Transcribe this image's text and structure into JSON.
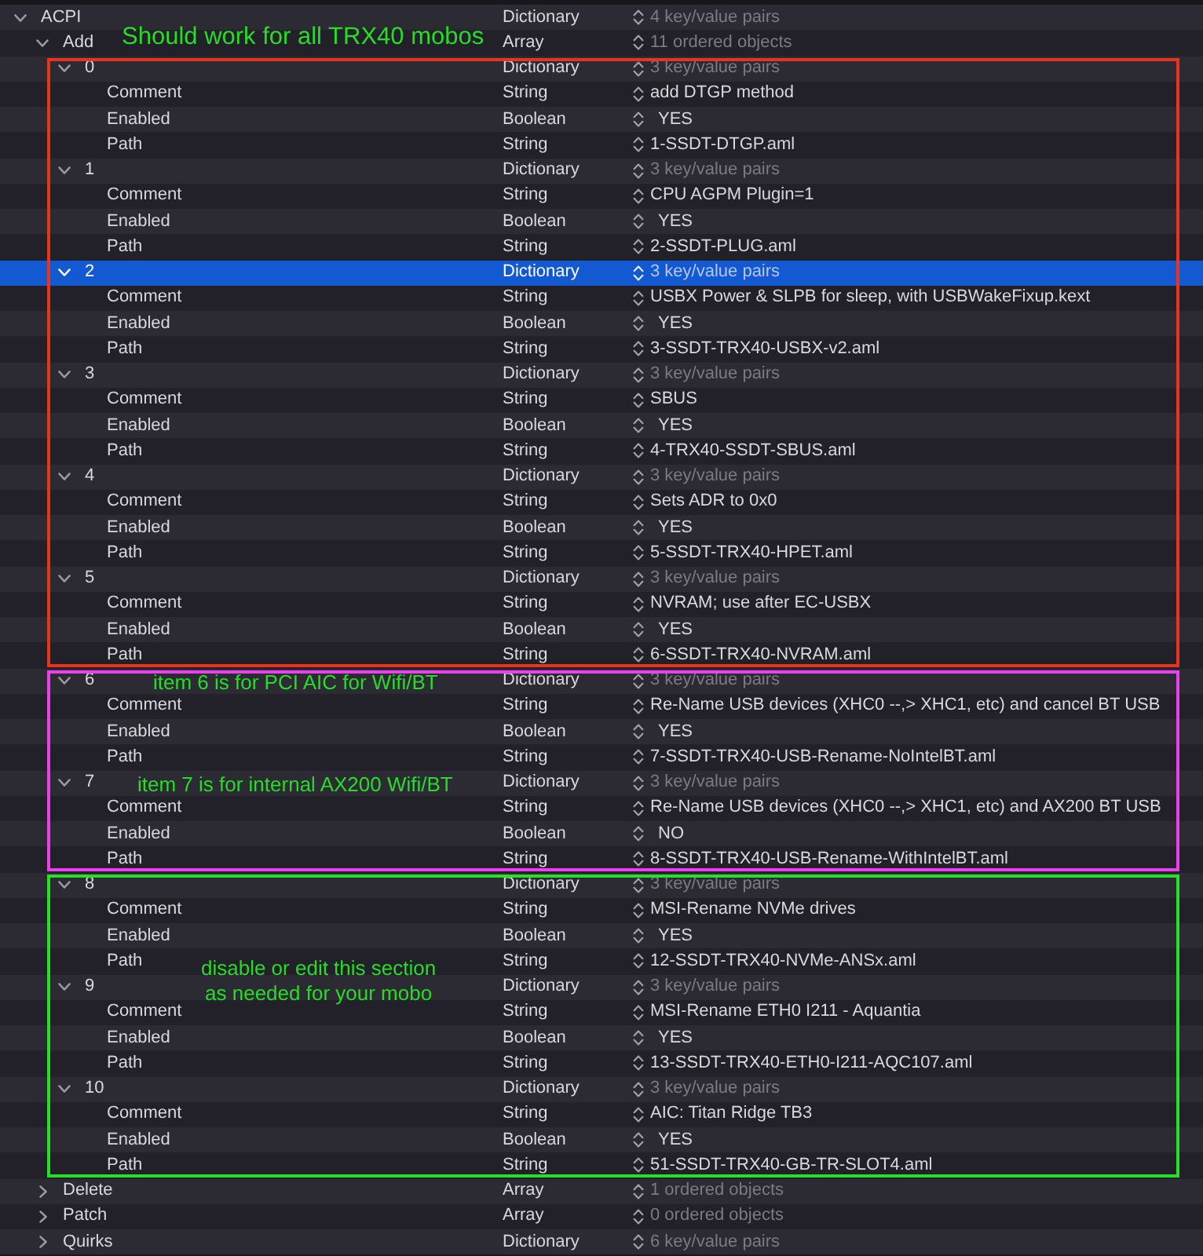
{
  "tree": [
    {
      "key": "ACPI",
      "type": "Dictionary",
      "value": "4 key/value pairs",
      "expanded": true,
      "selected": false,
      "children": [
        {
          "key": "Add",
          "type": "Array",
          "value": "11 ordered objects",
          "expanded": true,
          "selected": false,
          "sections": [
            {
              "color": "#e8341f",
              "note": {
                "kind": "above",
                "lines": [
                  "Should work for all TRX40 mobos"
                ]
              },
              "children": [
                {
                  "key": "0",
                  "type": "Dictionary",
                  "value": "3 key/value pairs",
                  "expanded": true,
                  "selected": false,
                  "children": [
                    {
                      "key": "Comment",
                      "type": "String",
                      "value": "add DTGP method",
                      "kind": "text",
                      "selected": false
                    },
                    {
                      "key": "Enabled",
                      "type": "Boolean",
                      "value": "YES",
                      "kind": "toggle",
                      "selected": false
                    },
                    {
                      "key": "Path",
                      "type": "String",
                      "value": "1-SSDT-DTGP.aml",
                      "kind": "text",
                      "selected": false
                    }
                  ]
                },
                {
                  "key": "1",
                  "type": "Dictionary",
                  "value": "3 key/value pairs",
                  "expanded": true,
                  "selected": false,
                  "children": [
                    {
                      "key": "Comment",
                      "type": "String",
                      "value": "CPU AGPM Plugin=1",
                      "kind": "text",
                      "selected": false
                    },
                    {
                      "key": "Enabled",
                      "type": "Boolean",
                      "value": "YES",
                      "kind": "toggle",
                      "selected": false
                    },
                    {
                      "key": "Path",
                      "type": "String",
                      "value": "2-SSDT-PLUG.aml",
                      "kind": "text",
                      "selected": false
                    }
                  ]
                },
                {
                  "key": "2",
                  "type": "Dictionary",
                  "value": "3 key/value pairs",
                  "expanded": true,
                  "selected": true,
                  "children": [
                    {
                      "key": "Comment",
                      "type": "String",
                      "value": "USBX Power & SLPB for sleep, with USBWakeFixup.kext",
                      "kind": "text",
                      "selected": false
                    },
                    {
                      "key": "Enabled",
                      "type": "Boolean",
                      "value": "YES",
                      "kind": "toggle",
                      "selected": false
                    },
                    {
                      "key": "Path",
                      "type": "String",
                      "value": "3-SSDT-TRX40-USBX-v2.aml",
                      "kind": "text",
                      "selected": false
                    }
                  ]
                },
                {
                  "key": "3",
                  "type": "Dictionary",
                  "value": "3 key/value pairs",
                  "expanded": true,
                  "selected": false,
                  "children": [
                    {
                      "key": "Comment",
                      "type": "String",
                      "value": "SBUS",
                      "kind": "text",
                      "selected": false
                    },
                    {
                      "key": "Enabled",
                      "type": "Boolean",
                      "value": "YES",
                      "kind": "toggle",
                      "selected": false
                    },
                    {
                      "key": "Path",
                      "type": "String",
                      "value": "4-TRX40-SSDT-SBUS.aml",
                      "kind": "text",
                      "selected": false
                    }
                  ]
                },
                {
                  "key": "4",
                  "type": "Dictionary",
                  "value": "3 key/value pairs",
                  "expanded": true,
                  "selected": false,
                  "children": [
                    {
                      "key": "Comment",
                      "type": "String",
                      "value": "Sets ADR to 0x0",
                      "kind": "text",
                      "selected": false
                    },
                    {
                      "key": "Enabled",
                      "type": "Boolean",
                      "value": "YES",
                      "kind": "toggle",
                      "selected": false
                    },
                    {
                      "key": "Path",
                      "type": "String",
                      "value": "5-SSDT-TRX40-HPET.aml",
                      "kind": "text",
                      "selected": false
                    }
                  ]
                },
                {
                  "key": "5",
                  "type": "Dictionary",
                  "value": "3 key/value pairs",
                  "expanded": true,
                  "selected": false,
                  "children": [
                    {
                      "key": "Comment",
                      "type": "String",
                      "value": "NVRAM; use after EC-USBX",
                      "kind": "text",
                      "selected": false
                    },
                    {
                      "key": "Enabled",
                      "type": "Boolean",
                      "value": "YES",
                      "kind": "toggle",
                      "selected": false
                    },
                    {
                      "key": "Path",
                      "type": "String",
                      "value": "6-SSDT-TRX40-NVRAM.aml",
                      "kind": "text",
                      "selected": false
                    }
                  ]
                }
              ]
            },
            {
              "color": "#ee3fee",
              "children": [
                {
                  "key": "6",
                  "type": "Dictionary",
                  "value": "3 key/value pairs",
                  "expanded": true,
                  "selected": false,
                  "note": {
                    "kind": "inline",
                    "lines": [
                      "item 6 is for PCI AIC for Wifi/BT"
                    ]
                  },
                  "children": [
                    {
                      "key": "Comment",
                      "type": "String",
                      "value": "Re-Name USB devices (XHC0 --,> XHC1, etc) and cancel BT USB",
                      "kind": "text",
                      "selected": false
                    },
                    {
                      "key": "Enabled",
                      "type": "Boolean",
                      "value": "YES",
                      "kind": "toggle",
                      "selected": false
                    },
                    {
                      "key": "Path",
                      "type": "String",
                      "value": "7-SSDT-TRX40-USB-Rename-NoIntelBT.aml",
                      "kind": "text",
                      "selected": false
                    }
                  ]
                },
                {
                  "key": "7",
                  "type": "Dictionary",
                  "value": "3 key/value pairs",
                  "expanded": true,
                  "selected": false,
                  "note": {
                    "kind": "inline",
                    "lines": [
                      "item 7 is for internal AX200 Wifi/BT"
                    ]
                  },
                  "children": [
                    {
                      "key": "Comment",
                      "type": "String",
                      "value": "Re-Name USB devices (XHC0 --,> XHC1, etc) and AX200 BT USB",
                      "kind": "text",
                      "selected": false
                    },
                    {
                      "key": "Enabled",
                      "type": "Boolean",
                      "value": "NO",
                      "kind": "toggle",
                      "selected": false
                    },
                    {
                      "key": "Path",
                      "type": "String",
                      "value": "8-SSDT-TRX40-USB-Rename-WithIntelBT.aml",
                      "kind": "text",
                      "selected": false
                    }
                  ]
                }
              ]
            },
            {
              "color": "#25e025",
              "note": {
                "kind": "after",
                "lines": [
                  "disable or edit this section",
                  "as needed for your mobo"
                ]
              },
              "children": [
                {
                  "key": "8",
                  "type": "Dictionary",
                  "value": "3 key/value pairs",
                  "expanded": true,
                  "selected": false,
                  "children": [
                    {
                      "key": "Comment",
                      "type": "String",
                      "value": "MSI-Rename NVMe drives",
                      "kind": "text",
                      "selected": false
                    },
                    {
                      "key": "Enabled",
                      "type": "Boolean",
                      "value": "YES",
                      "kind": "toggle",
                      "selected": false
                    },
                    {
                      "key": "Path",
                      "type": "String",
                      "value": "12-SSDT-TRX40-NVMe-ANSx.aml",
                      "kind": "text",
                      "selected": false
                    }
                  ]
                },
                {
                  "key": "9",
                  "type": "Dictionary",
                  "value": "3 key/value pairs",
                  "expanded": true,
                  "selected": false,
                  "children": [
                    {
                      "key": "Comment",
                      "type": "String",
                      "value": "MSI-Rename ETH0 I211 - Aquantia",
                      "kind": "text",
                      "selected": false
                    },
                    {
                      "key": "Enabled",
                      "type": "Boolean",
                      "value": "YES",
                      "kind": "toggle",
                      "selected": false
                    },
                    {
                      "key": "Path",
                      "type": "String",
                      "value": "13-SSDT-TRX40-ETH0-I211-AQC107.aml",
                      "kind": "text",
                      "selected": false
                    }
                  ]
                },
                {
                  "key": "10",
                  "type": "Dictionary",
                  "value": "3 key/value pairs",
                  "expanded": true,
                  "selected": false,
                  "children": [
                    {
                      "key": "Comment",
                      "type": "String",
                      "value": "AIC: Titan Ridge TB3",
                      "kind": "text",
                      "selected": false
                    },
                    {
                      "key": "Enabled",
                      "type": "Boolean",
                      "value": "YES",
                      "kind": "toggle",
                      "selected": false
                    },
                    {
                      "key": "Path",
                      "type": "String",
                      "value": "51-SSDT-TRX40-GB-TR-SLOT4.aml",
                      "kind": "text",
                      "selected": false
                    }
                  ]
                }
              ]
            }
          ]
        },
        {
          "key": "Delete",
          "type": "Array",
          "value": "1 ordered objects",
          "expanded": false,
          "selected": false
        },
        {
          "key": "Patch",
          "type": "Array",
          "value": "0 ordered objects",
          "expanded": false,
          "selected": false
        },
        {
          "key": "Quirks",
          "type": "Dictionary",
          "value": "6 key/value pairs",
          "expanded": false,
          "selected": false
        }
      ]
    }
  ]
}
